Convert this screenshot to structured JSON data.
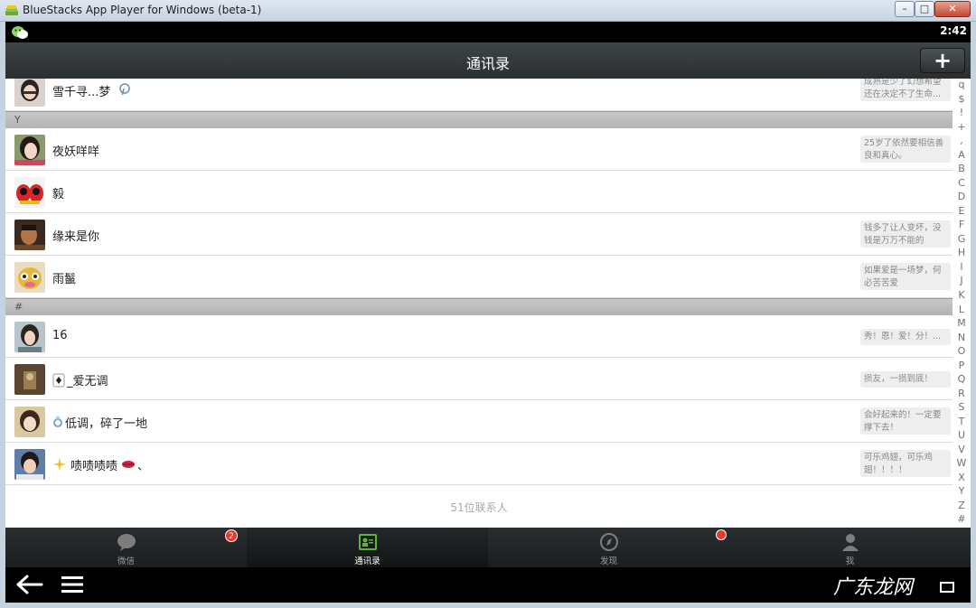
{
  "window": {
    "title": "BlueStacks App Player for Windows (beta-1)",
    "buttons": [
      "minimize",
      "maximize",
      "close"
    ]
  },
  "statusbar": {
    "time": "2:42",
    "app_icon": "wechat-icon"
  },
  "header": {
    "title": "通讯录",
    "add_label": "+"
  },
  "contacts_top": {
    "name": "雪千寻...梦",
    "signature": "成熟是少了幻想希望还在决定不了生命..."
  },
  "sections": [
    {
      "letter": "Y",
      "rows": [
        {
          "name": "夜妖咩咩",
          "signature": "25岁了依然要相信善良和真心。"
        },
        {
          "name": "毅",
          "signature": ""
        },
        {
          "name": "缘来是你",
          "signature": "钱多了让人变坏，没钱是万万不能的"
        },
        {
          "name": "雨鬣",
          "signature": "如果爱是一场梦，何必苦苦爱"
        }
      ]
    },
    {
      "letter": "#",
      "rows": [
        {
          "name": "16",
          "signature": "秀！恩！爱！分！..."
        },
        {
          "name": "_爱无调",
          "signature": "损友，一损到底！"
        },
        {
          "name": "低调，碎了一地",
          "signature": "会好起来的！一定要撑下去！"
        },
        {
          "name": "啧啧啧啧",
          "signature": "可乐鸡翅，可乐鸡翅！！！！"
        }
      ]
    }
  ],
  "contact_count": "51位联系人",
  "index_bar": [
    "q",
    "$",
    "!",
    "+",
    ",",
    "A",
    "B",
    "C",
    "D",
    "E",
    "F",
    "G",
    "H",
    "I",
    "J",
    "K",
    "L",
    "M",
    "N",
    "O",
    "P",
    "Q",
    "R",
    "S",
    "T",
    "U",
    "V",
    "W",
    "X",
    "Y",
    "Z",
    "#"
  ],
  "tabs": [
    {
      "label": "微信",
      "icon": "chat-bubble-icon",
      "badge": "2",
      "active": false
    },
    {
      "label": "通讯录",
      "icon": "contacts-icon",
      "badge": "",
      "active": true
    },
    {
      "label": "发现",
      "icon": "compass-icon",
      "badge": "dot",
      "active": false
    },
    {
      "label": "我",
      "icon": "person-icon",
      "badge": "",
      "active": false
    }
  ],
  "navbar": {
    "back_icon": "back-arrow-icon",
    "menu_icon": "menu-icon"
  },
  "watermark": "广东龙网",
  "colors": {
    "header_bg": "#2f3436",
    "active_tab_label": "#ffffff",
    "badge": "#e53b2e",
    "section_bg": "#bdbdbd"
  }
}
